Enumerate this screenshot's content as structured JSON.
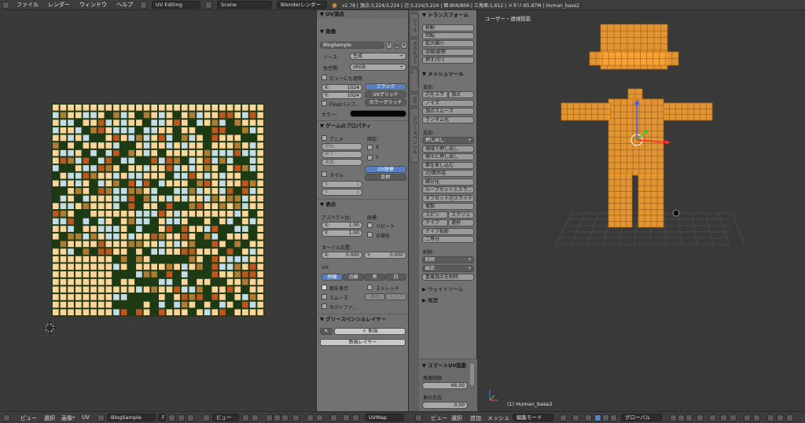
{
  "topbar": {
    "menu": [
      "ファイル",
      "レンダー",
      "ウィンドウ",
      "ヘルプ"
    ],
    "screen": "UV Editing",
    "scene": "Scene",
    "engine": "Blenderレンダー",
    "status": "v2.78 | 頂点:3,224/3,224 | 辺:3,224/3,224 | 面:806/806 | 三角面:1,612 | メモリ:65.87M | Human_base2"
  },
  "uv_panel": {
    "header": "UV頂点",
    "image_header": "画像",
    "image_name": "BlogSample",
    "image_f": "F",
    "source_label": "ソース:",
    "source_value": "生成",
    "colorspace_label": "色空間:",
    "colorspace_value": "sRGB",
    "use_view": "ビューにも適用",
    "x_label": "X:",
    "x_value": "1024",
    "y_label": "Y:",
    "y_value": "1024",
    "gen_blank": "ブランク",
    "gen_uvgrid": "UVグリッド",
    "gen_colorgrid": "カラーグリッド",
    "float_buffer": "Floatバッフ...",
    "color_label": "カラー:",
    "game_props_header": "ゲームのプロパティ",
    "anim": "アニメ",
    "clamp": "固定:",
    "start": "開始:",
    "end": "終了:",
    "speed": "速度:",
    "axis_x": "X",
    "axis_y": "Y",
    "tiles": "タイル",
    "uv_coord": "UV座標",
    "reflect": "反射",
    "tile_x": "X:",
    "tile_x_val": "1",
    "tile_y": "Y:",
    "tile_y_val": "1",
    "display_header": "表示",
    "aspect_label": "アスペクト比:",
    "coords_label": "座標:",
    "aspect_x": "X:",
    "aspect_x_val": "1.00",
    "aspect_y": "Y:",
    "aspect_y_val": "1.00",
    "repeat": "リピート",
    "normalized": "正規化",
    "cursor_label": "カーソル位置:",
    "cursor_x": "X:",
    "cursor_x_val": "0.000",
    "cursor_y": "Y:",
    "cursor_y_val": "0.000",
    "uv_label": "UV:",
    "uv_modes": [
      "枠線",
      "点線",
      "黒",
      "白"
    ],
    "show_faces": "面を表示",
    "stretch": "ストレッチ",
    "smooth": "スムーズ",
    "angle": "角度",
    "area": "エリア",
    "modified": "モディファ...",
    "gpencil_header": "グリースペンシルレイヤー",
    "new": "新規",
    "new_layer": "新規レイヤー"
  },
  "vtabs": [
    "ツール",
    "スカルプト",
    "オプション",
    "UV",
    "グリースペンシル"
  ],
  "tools": {
    "transform_header": "トランスフォーム",
    "transform": [
      "移動",
      "回転",
      "拡大縮小",
      "収縮/膨張",
      "押す/引く"
    ],
    "mesh_tools_header": "メッシュツール",
    "deform_label": "変形:",
    "slide_edge": "辺をスラ",
    "vertex": "頂点",
    "noise": "ノイズ",
    "smooth_verts": "頂点スムーズ",
    "randomize": "ランダム化",
    "add_label": "追加:",
    "extrude": "押し出し",
    "add_items": [
      "領域で押し出し",
      "個々に押し出し",
      "面を差し込む",
      "辺/面作成",
      "細分化",
      "ループカットとスラ...",
      "オフセット辺スライド",
      "複製"
    ],
    "spin": "スピン",
    "screw": "スクリュ",
    "knife": "ナイフ",
    "select": "選択",
    "knife_project": "ナイフ投影",
    "bisect": "二等分",
    "remove_label": "削除:",
    "delete": "削除",
    "merge": "結合",
    "remove_doubles": "重複頂点を削除",
    "weight_tools": "ウェイトツール",
    "history": "履歴",
    "smart_uv_header": "スマートUV投影",
    "angle_limit": "角度制限",
    "angle_limit_val": "66.00",
    "island_margin": "島の余白",
    "island_margin_val": "0.00"
  },
  "view3d": {
    "view_name": "ユーザー・透視投影",
    "object_label": "(1) Human_base2"
  },
  "bottombar": {
    "uv_menu": [
      "ビュー",
      "選択",
      "画像*",
      "UV"
    ],
    "image_name": "BlogSample",
    "image_f": "F",
    "view_label": "ビュー",
    "uvmap": "UVMap",
    "view3d_menu": [
      "ビュー",
      "選択",
      "追加",
      "メッシュ"
    ],
    "mode": "編集モード",
    "orientation": "グローバル"
  },
  "colors": {
    "orange": "#ffa431",
    "selected_blue": "#5680c2",
    "panel_gray": "#727272",
    "uv_cream": "#ffd49a",
    "uv_green": "#1d3a14",
    "uv_lightblue": "#c5dbe6",
    "uv_brown": "#b07b33",
    "uv_rust": "#c0561f"
  }
}
